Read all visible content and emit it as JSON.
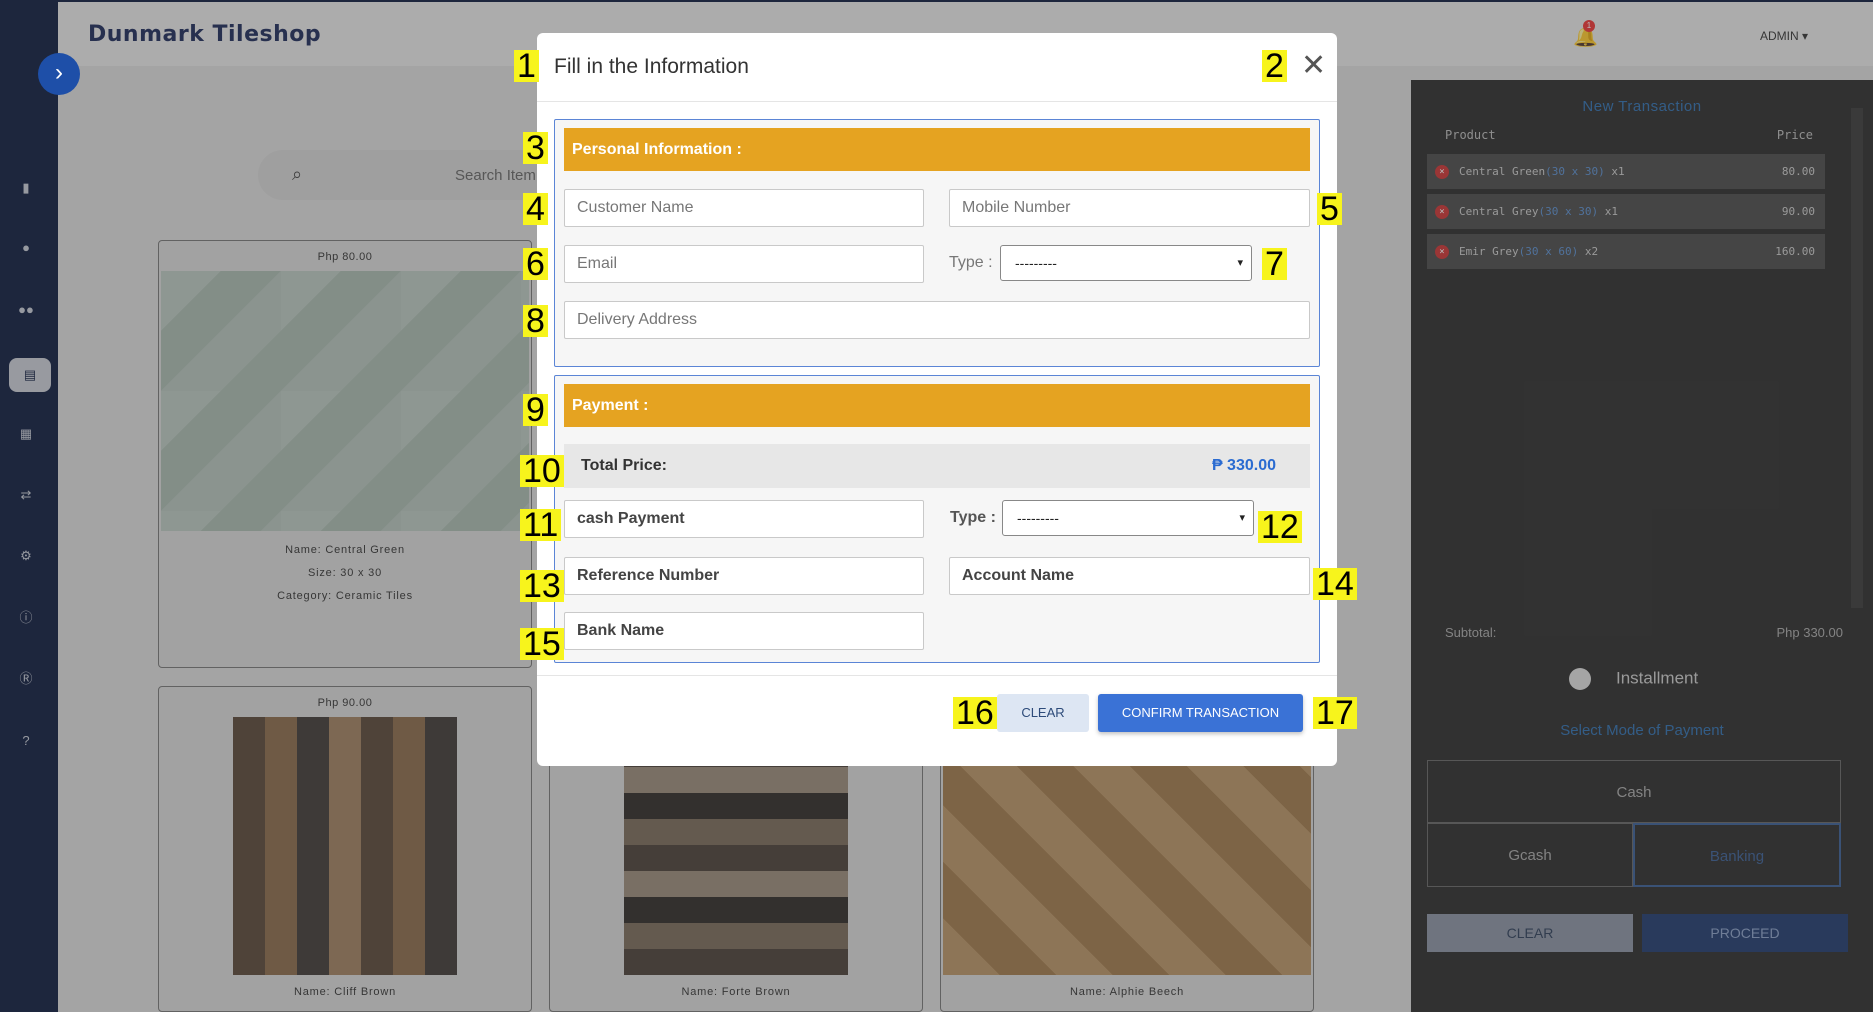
{
  "app": {
    "brand": "Dunmark Tileshop",
    "user": "ADMIN",
    "notification_count": "1"
  },
  "sidebar": {
    "toggle_icon": "chevron-right-icon",
    "items": [
      "chart-icon",
      "user-icon",
      "users-icon",
      "register-icon",
      "table-icon",
      "transfer-icon",
      "gear-icon",
      "info-icon",
      "r-icon",
      "help-icon"
    ]
  },
  "search": {
    "placeholder": "Search Item"
  },
  "products": [
    {
      "price": "Php 80.00",
      "name": "Name: Central Green",
      "size": "Size: 30 x 30",
      "category": "Category: Ceramic Tiles"
    },
    {
      "price": "Php 90.00",
      "name": "Name: Cliff Brown"
    },
    {
      "name": "Name: Forte Brown"
    },
    {
      "name": "Name: Alphie Beech"
    }
  ],
  "transaction": {
    "title": "New Transaction",
    "col_product": "Product",
    "col_price": "Price",
    "items": [
      {
        "name": "Central Green",
        "size": "(30 x 30)",
        "qty": "x1",
        "price": "80.00"
      },
      {
        "name": "Central Grey",
        "size": "(30 x 30)",
        "qty": "x1",
        "price": "90.00"
      },
      {
        "name": "Emir Grey",
        "size": "(30 x 60)",
        "qty": "x2",
        "price": "160.00"
      }
    ],
    "subtotal_label": "Subtotal:",
    "subtotal_value": "Php 330.00",
    "installment": "Installment",
    "mode_label": "Select Mode of Payment",
    "modes": [
      "Cash",
      "Gcash",
      "Banking"
    ],
    "clear": "CLEAR",
    "proceed": "PROCEED"
  },
  "modal": {
    "title": "Fill in the Information",
    "close_icon": "close-icon",
    "personal": {
      "header": "Personal Information :",
      "customer_name": "Customer Name",
      "mobile_number": "Mobile Number",
      "email": "Email",
      "type_label": "Type :",
      "type_value": "---------",
      "delivery_address": "Delivery Address"
    },
    "payment": {
      "header": "Payment :",
      "total_label": "Total Price:",
      "total_value": "₱ 330.00",
      "cash_payment": "cash Payment",
      "type_label": "Type :",
      "type_value": "---------",
      "reference_number": "Reference Number",
      "account_name": "Account Name",
      "bank_name": "Bank Name"
    },
    "clear_button": "CLEAR",
    "confirm_button": "CONFIRM TRANSACTION"
  },
  "tags": [
    "1",
    "2",
    "3",
    "4",
    "5",
    "6",
    "7",
    "8",
    "9",
    "10",
    "11",
    "12",
    "13",
    "14",
    "15",
    "16",
    "17"
  ]
}
